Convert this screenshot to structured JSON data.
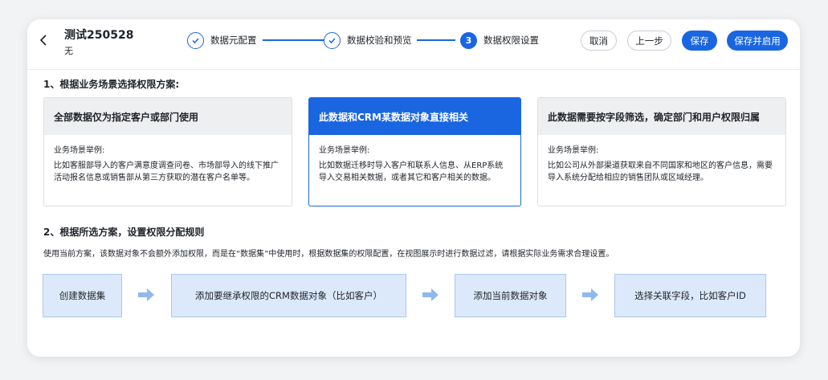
{
  "header": {
    "back_icon": "chevron-left-icon",
    "title": "测试250528",
    "subtitle": "无"
  },
  "steps": [
    {
      "label": "数据元配置",
      "status": "done"
    },
    {
      "label": "数据校验和预览",
      "status": "done"
    },
    {
      "number": "3",
      "label": "数据权限设置",
      "status": "active"
    }
  ],
  "buttons": {
    "cancel": "取消",
    "prev": "上一步",
    "save": "保存",
    "save_enable": "保存并启用"
  },
  "section1": {
    "title": "1、根据业务场景选择权限方案:"
  },
  "plans": [
    {
      "title": "全部数据仅为指定客户或部门使用",
      "example_label": "业务场景举例:",
      "description": "比如客服部导入的客户满意度调查问卷、市场部导入的线下推广活动报名信息或销售部从第三方获取的潜在客户名单等。",
      "selected": false
    },
    {
      "title": "此数据和CRM某数据对象直接相关",
      "example_label": "业务场景举例:",
      "description": "比如数据迁移时导入客户和联系人信息、从ERP系统导入交易相关数据，或者其它和客户相关的数据。",
      "selected": true
    },
    {
      "title": "此数据需要按字段筛选，确定部门和用户权限归属",
      "example_label": "业务场景举例:",
      "description": "比如公司从外部渠道获取来自不同国家和地区的客户信息，需要导入系统分配给相应的销售团队或区域经理。",
      "selected": false
    }
  ],
  "section2": {
    "title": "2、根据所选方案，设置权限分配规则",
    "description": "使用当前方案，该数据对象不会额外添加权限，而是在“数据集”中使用时，根据数据集的权限配置，在视图展示时进行数据过滤，请根据实际业务需求合理设置。"
  },
  "flow": [
    "创建数据集",
    "添加要继承权限的CRM数据对象（比如客户）",
    "添加当前数据对象",
    "选择关联字段，比如客户ID"
  ],
  "colors": {
    "accent": "#1a66e0",
    "flow_box": "#dbe9fb",
    "flow_arrow": "#8fb8ef"
  }
}
